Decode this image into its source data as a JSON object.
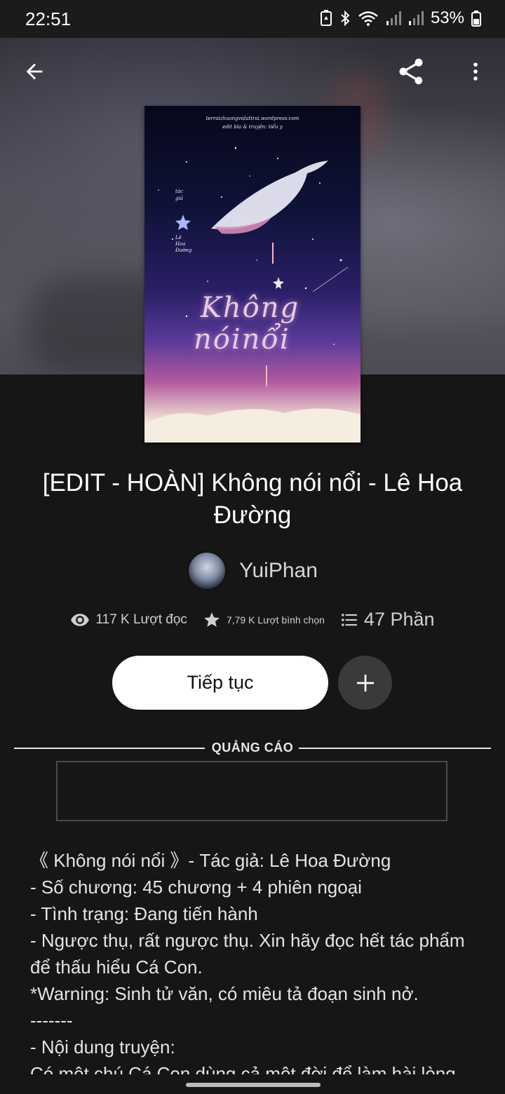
{
  "status_bar": {
    "time": "22:51",
    "battery": "53%"
  },
  "book": {
    "title": "[EDIT - HOÀN] Không nói nổi - Lê Hoa Đường",
    "author": "YuiPhan",
    "cover": {
      "credit_line1": "terraizhuongvidattrai.wordpress.com",
      "credit_line2": "edit bìa & truyện: tiểu y",
      "author_label1": "tác",
      "author_label2": "giả",
      "author_name1": "Lê",
      "author_name2": "Hoa",
      "author_name3": "Đường",
      "title_line1": "Không",
      "title_line2": "nóinổi"
    }
  },
  "stats": {
    "reads": "117 K Lượt đọc",
    "votes": "7,79 K Lượt bình chọn",
    "parts": "47 Phần"
  },
  "actions": {
    "continue_label": "Tiếp tục"
  },
  "ad": {
    "label": "QUẢNG CÁO"
  },
  "description": {
    "lines": [
      "《 Không nói nổi 》- Tác giả: Lê Hoa Đường",
      "- Số chương: 45 chương + 4 phiên ngoại",
      "- Tình trạng: Đang tiến hành",
      "- Ngược thụ, rất ngược thụ. Xin hãy đọc hết tác phẩm",
      "để thấu hiểu Cá Con.",
      "*Warning: Sinh tử văn, có miêu tả đoạn sinh nở.",
      "-------",
      "- Nội dung truyện:",
      "Có một chú Cá Con dùng cả một đời để làm hài lòng"
    ]
  }
}
